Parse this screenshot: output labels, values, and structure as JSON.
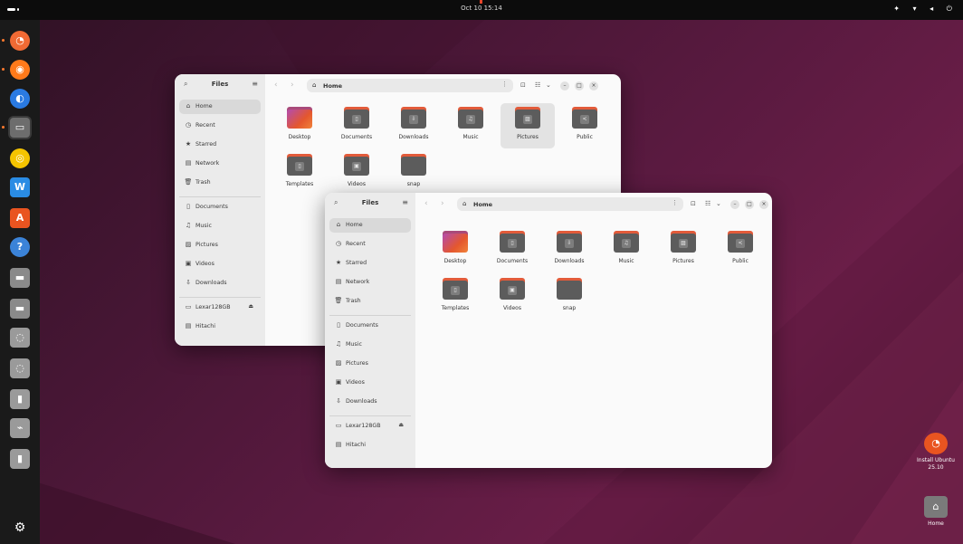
{
  "top_bar": {
    "clock": "Oct 10 15:14",
    "tray_icons": [
      "accessibility-icon",
      "network-icon",
      "volume-icon",
      "power-icon"
    ],
    "tray_glyphs": "✦ ▾ ◂ ⏻"
  },
  "dock": {
    "items": [
      {
        "name": "software-updater-icon",
        "color": "#f06a34",
        "glyph": "◔"
      },
      {
        "name": "firefox-icon",
        "color": "#ff7a1a",
        "glyph": "◉"
      },
      {
        "name": "thunderbird-icon",
        "color": "#2a7ae2",
        "glyph": "◐"
      },
      {
        "name": "files-icon",
        "color": "#6d6d6d",
        "glyph": "▭",
        "active": true
      },
      {
        "name": "rhythmbox-icon",
        "color": "#f5c400",
        "glyph": "◎"
      },
      {
        "name": "libreoffice-writer-icon",
        "color": "#2a8ce4",
        "glyph": "W"
      },
      {
        "name": "app-center-icon",
        "color": "#e95420",
        "glyph": "A"
      },
      {
        "name": "help-icon",
        "color": "#3b83d8",
        "glyph": "?"
      },
      {
        "name": "drive-icon",
        "color": "#8a8a8a",
        "glyph": "▬"
      },
      {
        "name": "drive-icon",
        "color": "#8a8a8a",
        "glyph": "▬"
      },
      {
        "name": "optical-drive-icon",
        "color": "#9a9a9a",
        "glyph": "◌"
      },
      {
        "name": "optical-drive-icon",
        "color": "#9a9a9a",
        "glyph": "◌"
      },
      {
        "name": "usb-drive-icon",
        "color": "#9a9a9a",
        "glyph": "▮"
      },
      {
        "name": "usb-drive-icon",
        "color": "#9a9a9a",
        "glyph": "⌁"
      },
      {
        "name": "usb-drive-icon",
        "color": "#9a9a9a",
        "glyph": "▮"
      }
    ],
    "show_apps_glyph": "⚙"
  },
  "window_back": {
    "sidebar_title": "Files",
    "path": "Home",
    "sidebar_items": [
      {
        "icon": "⌂",
        "label": "Home",
        "selected": true
      },
      {
        "icon": "◷",
        "label": "Recent"
      },
      {
        "icon": "★",
        "label": "Starred"
      },
      {
        "icon": "▤",
        "label": "Network"
      },
      {
        "icon": "🗑",
        "label": "Trash"
      }
    ],
    "sidebar_bookmarks": [
      {
        "icon": "▯",
        "label": "Documents"
      },
      {
        "icon": "♫",
        "label": "Music"
      },
      {
        "icon": "▨",
        "label": "Pictures"
      },
      {
        "icon": "▣",
        "label": "Videos"
      },
      {
        "icon": "⇩",
        "label": "Downloads"
      }
    ],
    "sidebar_devices": [
      {
        "icon": "▭",
        "label": "Lexar128GB",
        "eject": "⏏"
      },
      {
        "icon": "▤",
        "label": "Hitachi"
      }
    ],
    "files": [
      {
        "name": "Desktop",
        "glyph": ""
      },
      {
        "name": "Documents",
        "glyph": "▯"
      },
      {
        "name": "Downloads",
        "glyph": "⇩"
      },
      {
        "name": "Music",
        "glyph": "♫"
      },
      {
        "name": "Pictures",
        "glyph": "▨",
        "selected": true
      },
      {
        "name": "Public",
        "glyph": "<"
      },
      {
        "name": "Templates",
        "glyph": "▯"
      },
      {
        "name": "Videos",
        "glyph": "▣"
      },
      {
        "name": "snap",
        "glyph": ""
      }
    ]
  },
  "window_front": {
    "sidebar_title": "Files",
    "path": "Home",
    "sidebar_items": [
      {
        "icon": "⌂",
        "label": "Home",
        "selected": true
      },
      {
        "icon": "◷",
        "label": "Recent"
      },
      {
        "icon": "★",
        "label": "Starred"
      },
      {
        "icon": "▤",
        "label": "Network"
      },
      {
        "icon": "🗑",
        "label": "Trash"
      }
    ],
    "sidebar_bookmarks": [
      {
        "icon": "▯",
        "label": "Documents"
      },
      {
        "icon": "♫",
        "label": "Music"
      },
      {
        "icon": "▨",
        "label": "Pictures"
      },
      {
        "icon": "▣",
        "label": "Videos"
      },
      {
        "icon": "⇩",
        "label": "Downloads"
      }
    ],
    "sidebar_devices": [
      {
        "icon": "▭",
        "label": "Lexar128GB",
        "eject": "⏏"
      },
      {
        "icon": "▤",
        "label": "Hitachi"
      }
    ],
    "files": [
      {
        "name": "Desktop",
        "glyph": ""
      },
      {
        "name": "Documents",
        "glyph": "▯"
      },
      {
        "name": "Downloads",
        "glyph": "⇩"
      },
      {
        "name": "Music",
        "glyph": "♫"
      },
      {
        "name": "Pictures",
        "glyph": "▨"
      },
      {
        "name": "Public",
        "glyph": "<"
      },
      {
        "name": "Templates",
        "glyph": "▯"
      },
      {
        "name": "Videos",
        "glyph": "▣"
      },
      {
        "name": "snap",
        "glyph": ""
      }
    ]
  },
  "header_controls": {
    "back": "‹",
    "forward": "›",
    "home_glyph": "⌂",
    "more": "⋮",
    "new_folder": "⊡",
    "view": "☷",
    "view_dropdown": "⌄",
    "minimize": "–",
    "maximize": "□",
    "close": "×",
    "search": "⌕",
    "menu": "≡"
  },
  "desktop_icons": [
    {
      "name": "Install Ubuntu 25.10",
      "color": "#e95420",
      "glyph": "◔"
    },
    {
      "name": "Home",
      "color": "#7a7a7a",
      "glyph": "⌂"
    }
  ],
  "colors": {
    "accent": "#e95420",
    "folder_tab": "#e25b3a",
    "folder_body": "#5c5c5c"
  }
}
